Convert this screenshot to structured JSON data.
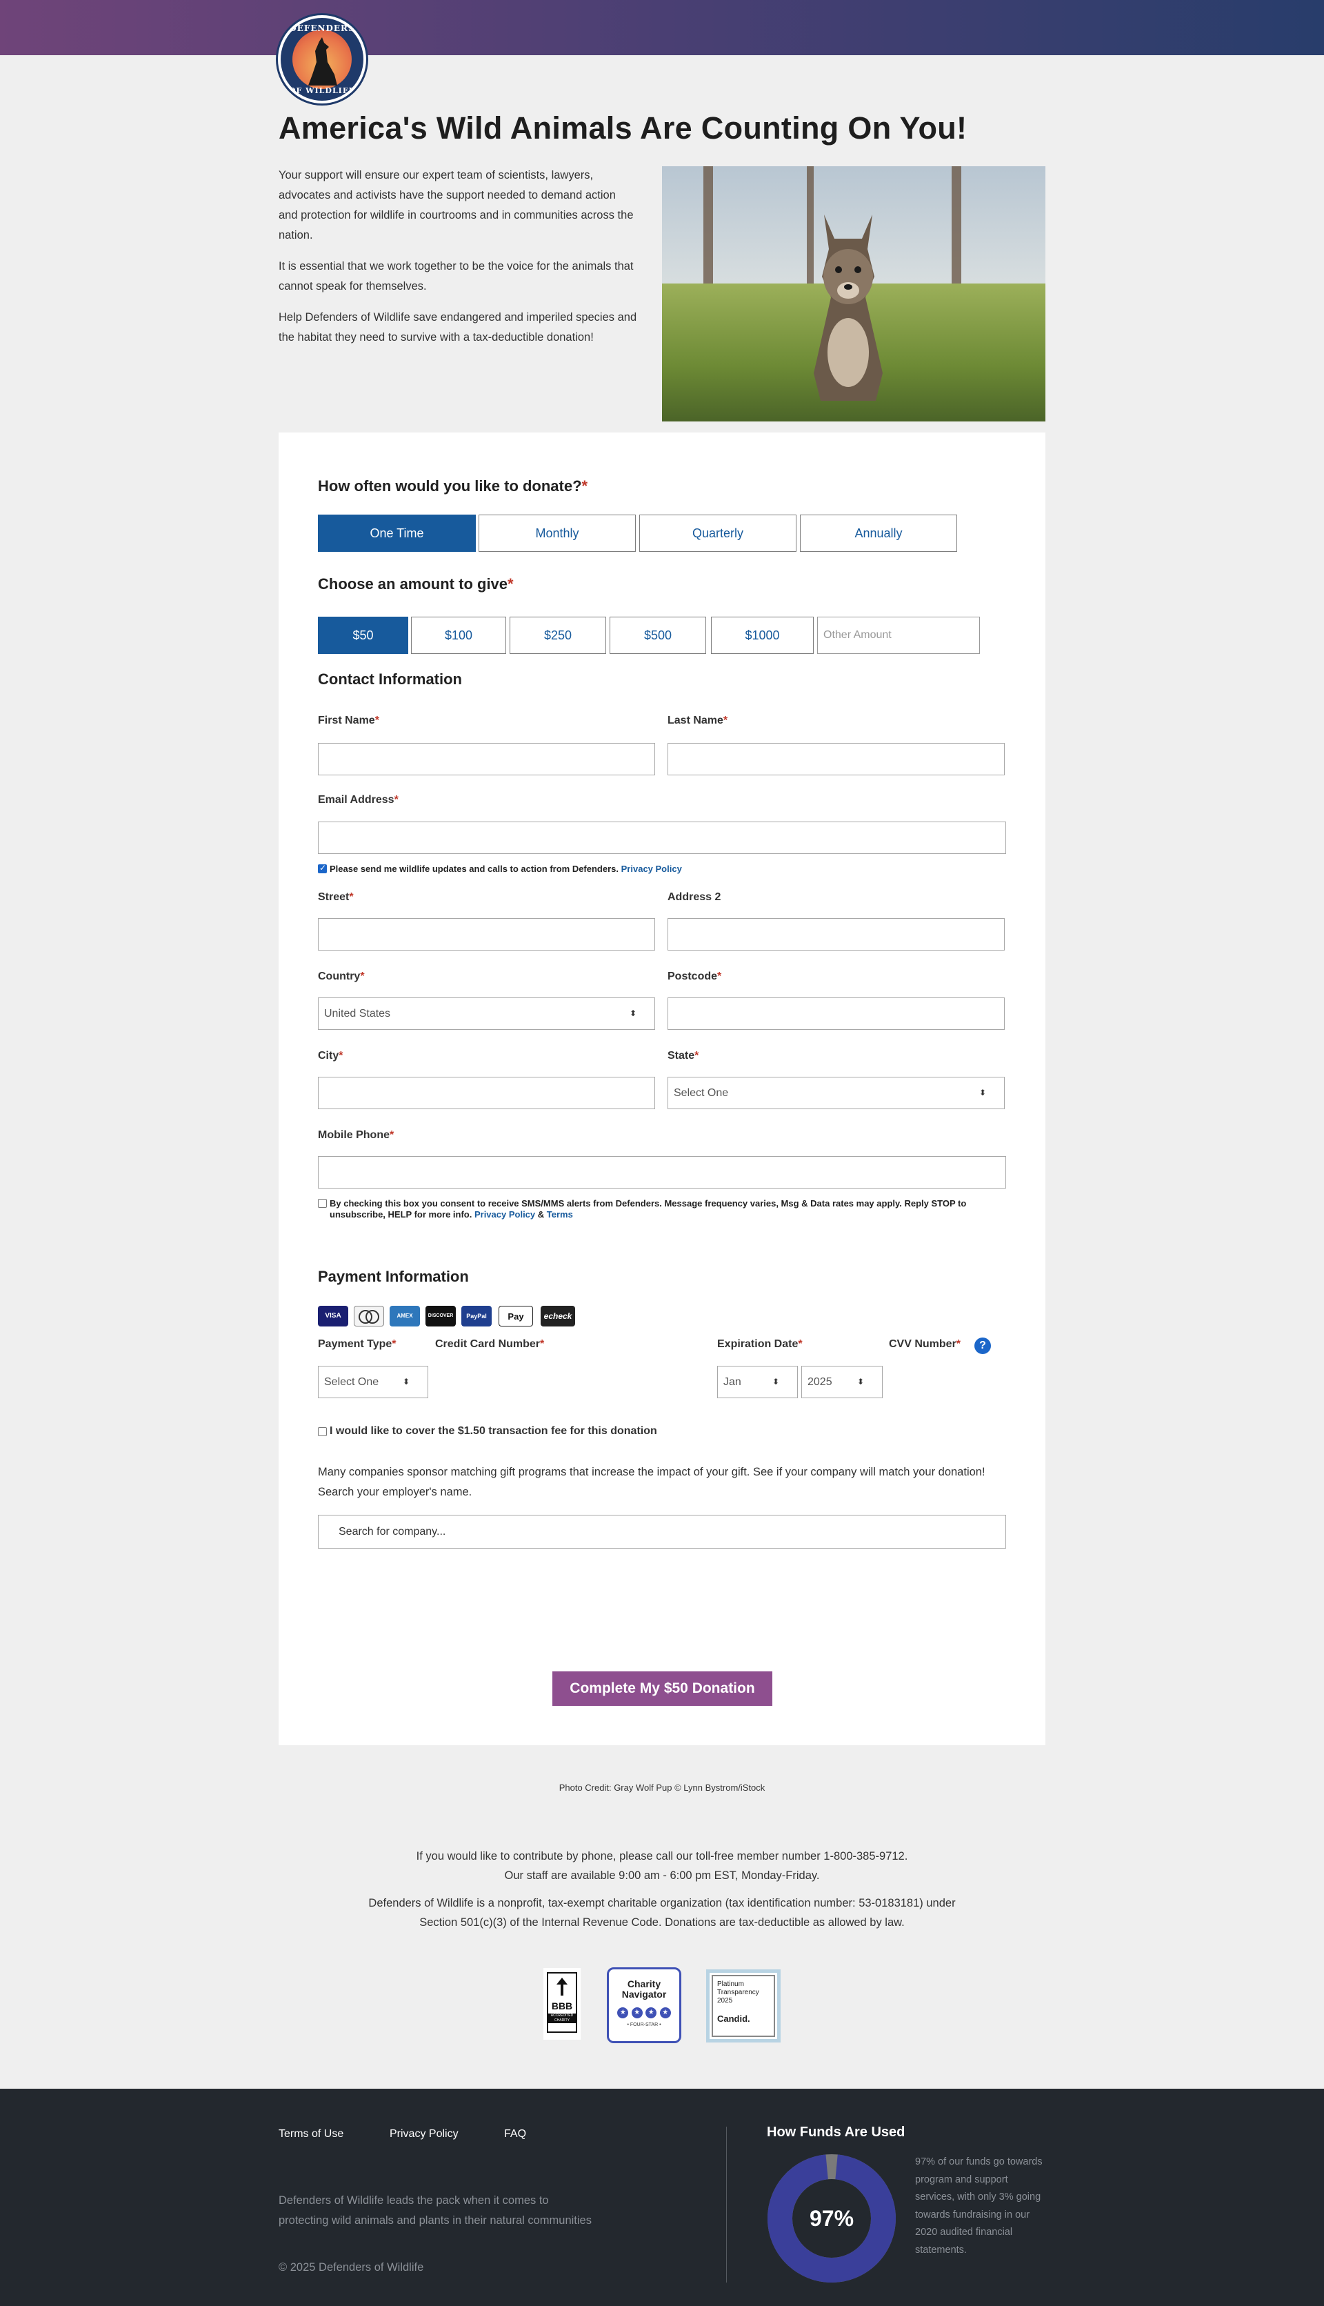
{
  "header": {
    "logo_top_text": "DEFENDERS",
    "logo_bottom_text": "OF WILDLIFE",
    "gradient": [
      "#6f4479",
      "#283d6b"
    ]
  },
  "hero": {
    "headline": "America's Wild Animals Are Counting On You!",
    "paragraphs": [
      "Your support will ensure our expert team of scientists, lawyers, advocates and activists have the support needed to demand action and protection for wildlife in courtrooms and in communities across the nation.",
      "It is essential that we work together to be the voice for the animals that cannot speak for themselves.",
      "Help Defenders of Wildlife save endangered and imperiled species and the habitat they need to survive with a tax-deductible donation!"
    ]
  },
  "frequency": {
    "question": "How often would you like to donate?",
    "required": "*",
    "options": [
      "One Time",
      "Monthly",
      "Quarterly",
      "Annually"
    ],
    "selected": "One Time"
  },
  "amount": {
    "question": "Choose an amount to give",
    "required": "*",
    "options": [
      "$50",
      "$100",
      "$250",
      "$500",
      "$1000"
    ],
    "selected": "$50",
    "other_placeholder": "Other Amount"
  },
  "contact": {
    "title": "Contact Information",
    "first_name": "First Name",
    "last_name": "Last Name",
    "email": "Email Address",
    "email_opt_in": "Please send me wildlife updates and calls to action from Defenders.",
    "privacy_policy": "Privacy Policy",
    "street": "Street",
    "address2": "Address 2",
    "country": "Country",
    "country_value": "United States",
    "postcode": "Postcode",
    "city": "City",
    "state": "State",
    "state_value": "Select One",
    "mobile_phone": "Mobile Phone",
    "sms_consent": "By checking this box you consent to receive SMS/MMS alerts from Defenders. Message frequency varies, Msg & Data rates may apply. Reply STOP to unsubscribe, HELP for more info.",
    "amp": "&",
    "terms": "Terms",
    "asterisk": "*"
  },
  "payment": {
    "title": "Payment Information",
    "methods": [
      "VISA",
      "MC",
      "AMEX",
      "DISCOVER",
      "PayPal",
      "Pay",
      "echeck"
    ],
    "payment_type": "Payment Type",
    "payment_type_value": "Select One",
    "card_number": "Credit Card Number",
    "expiration": "Expiration Date",
    "exp_month": "Jan",
    "exp_year": "2025",
    "cvv": "CVV Number",
    "help": "?",
    "cover_fee": "I would like to cover the $1.50 transaction fee for this donation",
    "matching_text": "Many companies sponsor matching gift programs that increase the impact of your gift. See if your company will match your donation! Search your employer's name.",
    "search_placeholder": "Search for company...",
    "submit_label": "Complete My $50 Donation",
    "submit_color": "#8e4f8f"
  },
  "credits": {
    "photo_credit": "Photo Credit: Gray Wolf Pup © Lynn Bystrom/iStock",
    "phone_line1": "If you would like to contribute by phone, please call our toll-free member number 1-800-385-9712.",
    "phone_line2": "Our staff are available 9:00 am - 6:00 pm EST, Monday-Friday.",
    "nonprofit": "Defenders of Wildlife is a nonprofit, tax-exempt charitable organization  (tax identification number:  53-0183181) under Section 501(c)(3) of the Internal Revenue Code. Donations are tax-deductible as allowed by law."
  },
  "badges": {
    "bbb": "BBB",
    "bbb_sub": "ACCREDITED CHARITY",
    "charity_navigator": "Charity Navigator",
    "four_star": "• FOUR-STAR •",
    "candid_line1": "Platinum",
    "candid_line2": "Transparency",
    "candid_year": "2025",
    "candid": "Candid."
  },
  "footer": {
    "links": [
      "Terms of Use",
      "Privacy Policy",
      "FAQ"
    ],
    "description": "Defenders of Wildlife leads the pack when it comes to protecting wild animals and plants in their natural communities",
    "copyright": "© 2025 Defenders of Wildlife",
    "funds_title": "How Funds Are Used",
    "funds_percent": "97%",
    "funds_value": 97,
    "funds_note": "97% of our funds go towards program and support services, with only 3% going towards fundraising in our 2020 audited financial statements."
  }
}
